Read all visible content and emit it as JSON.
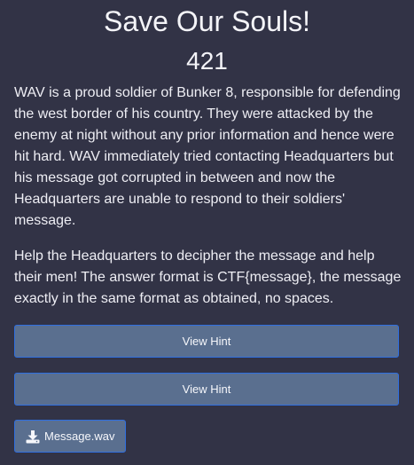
{
  "challenge": {
    "title": "Save Our Souls!",
    "points": "421",
    "description_1": "WAV is a proud soldier of Bunker 8, responsible for defending the west border of his country. They were attacked by the enemy at night without any prior information and hence were hit hard. WAV immediately tried contacting Headquarters but his message got corrupted in between and now the Headquarters are unable to respond to their soldiers' message.",
    "description_2": "Help the Headquarters to decipher the message and help their men! The answer format is CTF{message}, the message exactly in the same format as obtained, no spaces."
  },
  "hints": [
    {
      "label": "View Hint"
    },
    {
      "label": "View Hint"
    }
  ],
  "files": [
    {
      "name": "Message.wav",
      "icon": "download-icon"
    }
  ],
  "colors": {
    "background": "#323346",
    "button": "#5a6f8f",
    "button_border": "#2f6fe0",
    "text": "#f2f2f7"
  }
}
